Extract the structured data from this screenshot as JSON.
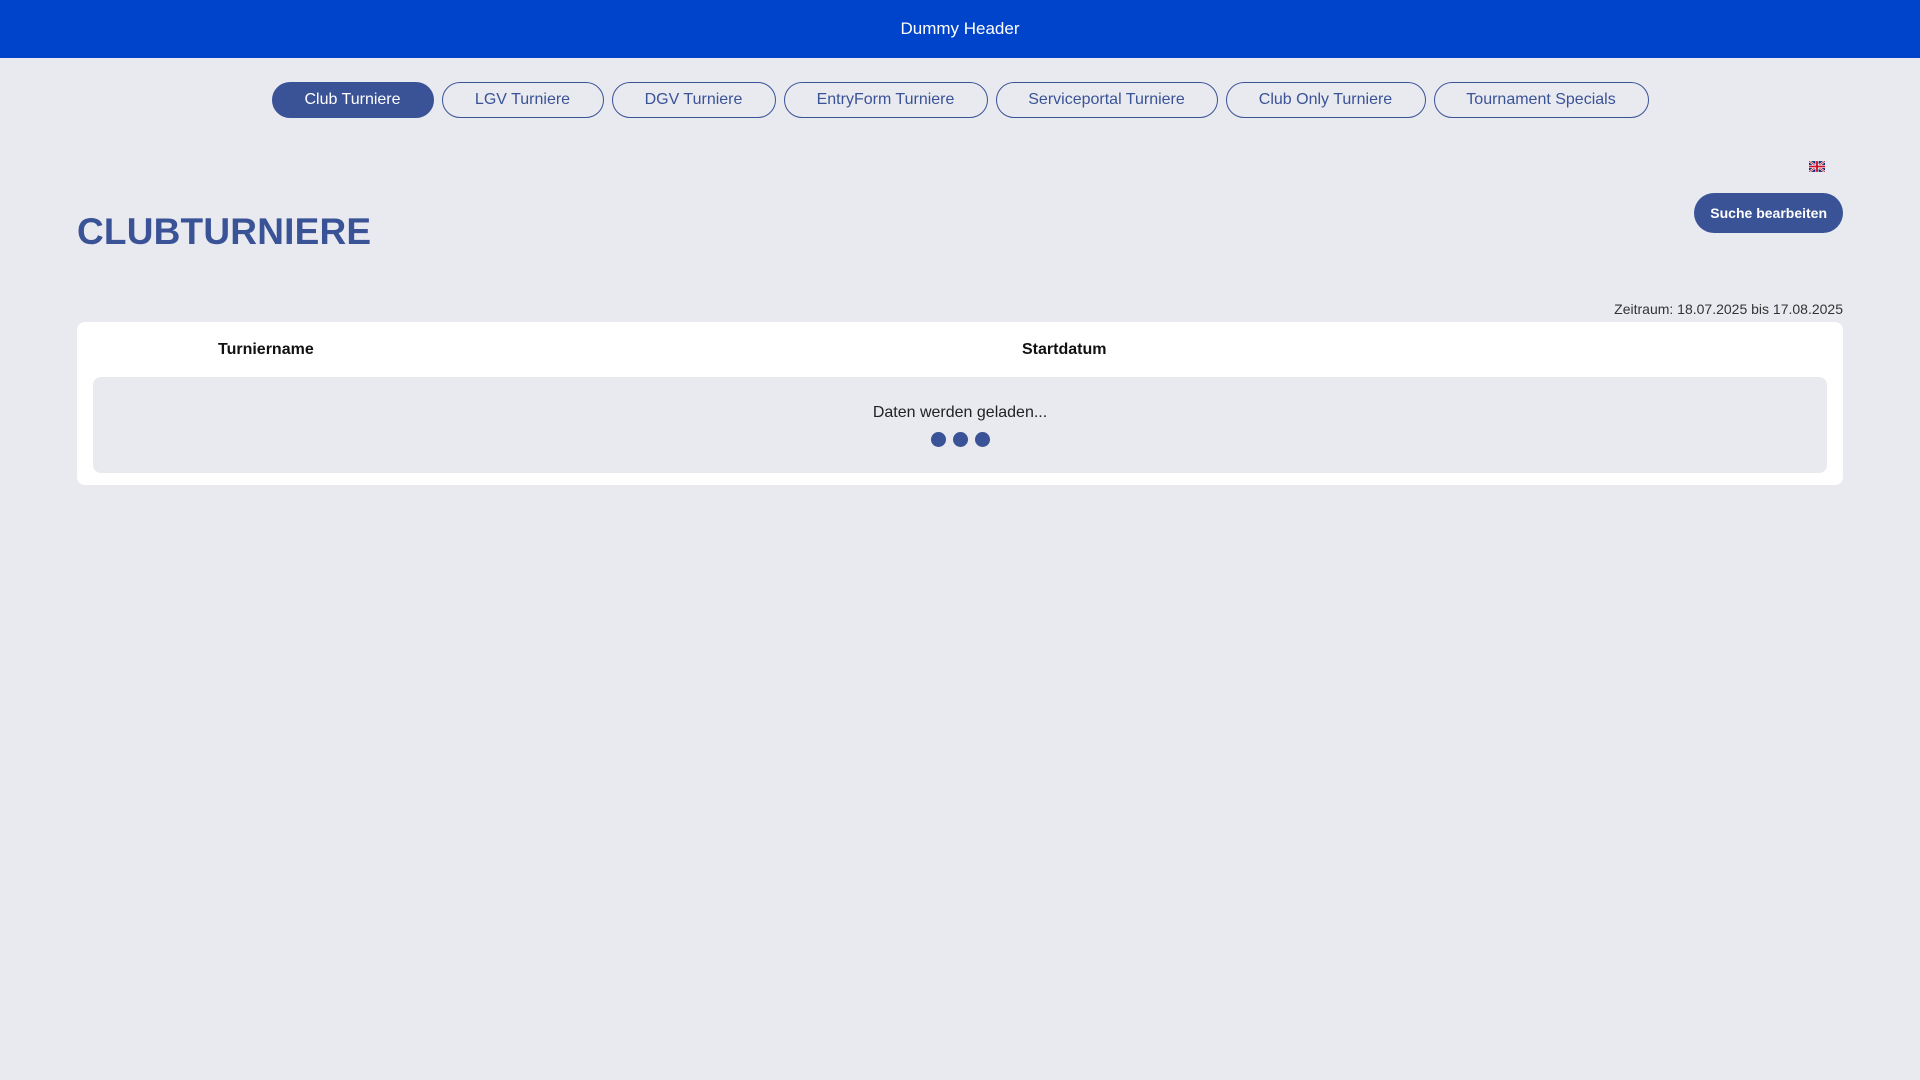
{
  "header": {
    "title": "Dummy Header"
  },
  "tabs": [
    {
      "label": "Club Turniere",
      "active": true
    },
    {
      "label": "LGV Turniere",
      "active": false
    },
    {
      "label": "DGV Turniere",
      "active": false
    },
    {
      "label": "EntryForm Turniere",
      "active": false
    },
    {
      "label": "Serviceportal Turniere",
      "active": false
    },
    {
      "label": "Club Only Turniere",
      "active": false
    },
    {
      "label": "Tournament Specials",
      "active": false
    }
  ],
  "language": {
    "icon": "uk-flag-icon"
  },
  "page": {
    "title": "CLUBTURNIERE",
    "edit_search_label": "Suche bearbeiten",
    "period": "Zeitraum: 18.07.2025 bis 17.08.2025"
  },
  "table": {
    "columns": [
      "Turniername",
      "Startdatum"
    ],
    "loading_text": "Daten werden geladen..."
  },
  "colors": {
    "header_bg": "#0044cc",
    "accent": "#3a5396",
    "page_bg": "#e9eaf0"
  }
}
